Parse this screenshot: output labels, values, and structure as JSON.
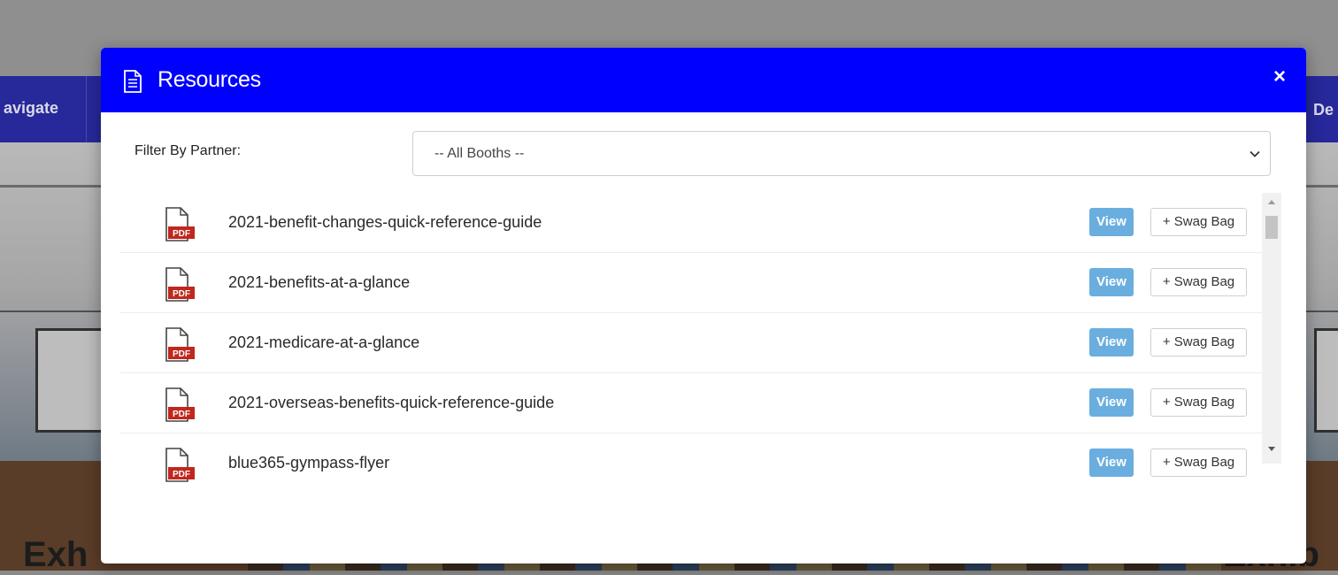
{
  "background": {
    "nav_left_text": "avigate",
    "nav_right_text": "De",
    "exhibit_left_text": "Exh",
    "exhibit_right_text": "Exhib"
  },
  "modal": {
    "title": "Resources",
    "header_color": "#0000ff",
    "close_label": "×",
    "header_icon": "document-icon"
  },
  "filter": {
    "label": "Filter By Partner:",
    "selected": "-- All Booths --"
  },
  "resources": [
    {
      "name": "2021-benefit-changes-quick-reference-guide",
      "view_label": "View",
      "swag_label": "+ Swag Bag",
      "icon": "pdf-icon"
    },
    {
      "name": "2021-benefits-at-a-glance",
      "view_label": "View",
      "swag_label": "+ Swag Bag",
      "icon": "pdf-icon"
    },
    {
      "name": "2021-medicare-at-a-glance",
      "view_label": "View",
      "swag_label": "+ Swag Bag",
      "icon": "pdf-icon"
    },
    {
      "name": "2021-overseas-benefits-quick-reference-guide",
      "view_label": "View",
      "swag_label": "+ Swag Bag",
      "icon": "pdf-icon"
    },
    {
      "name": "blue365-gympass-flyer",
      "view_label": "View",
      "swag_label": "+ Swag Bag",
      "icon": "pdf-icon"
    }
  ],
  "colors": {
    "view_button": "#6aaee0",
    "pdf_red": "#c0271d"
  }
}
